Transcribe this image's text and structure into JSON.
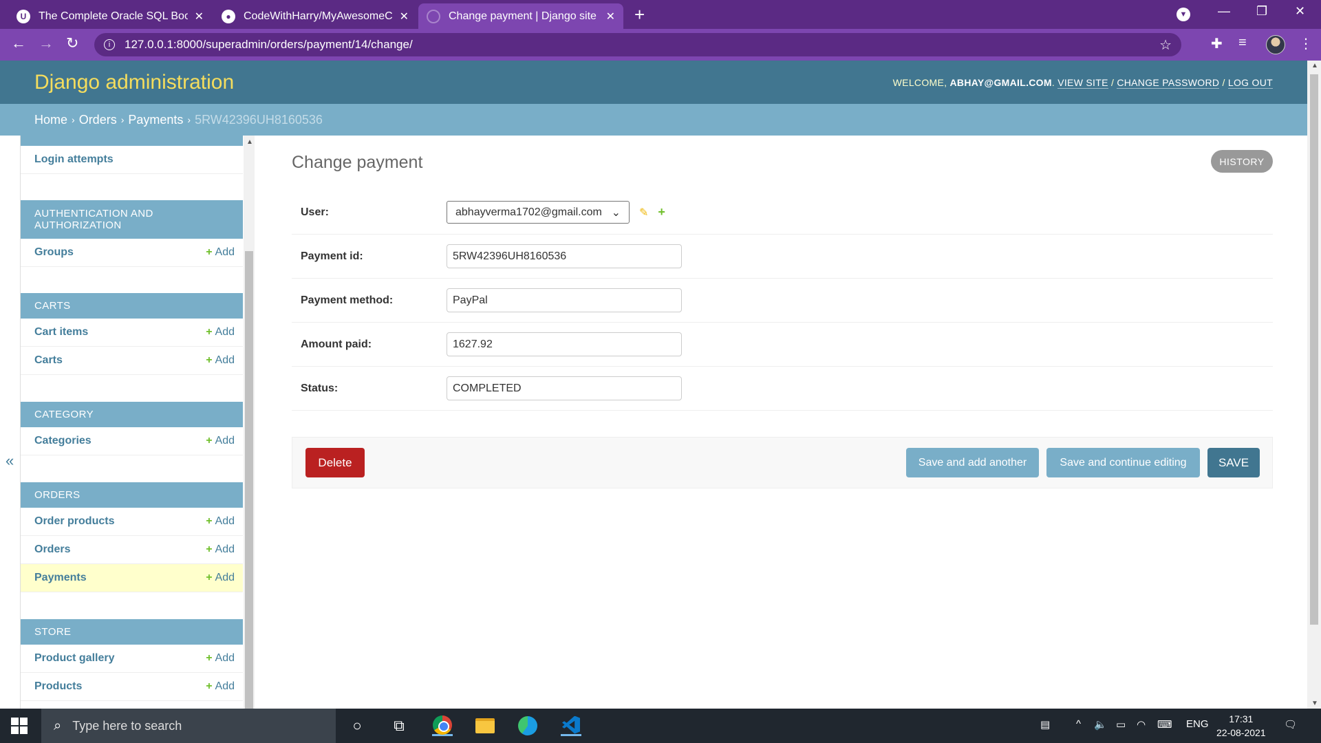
{
  "browser": {
    "tabs": [
      {
        "title": "The Complete Oracle SQL Bootcamp",
        "icon": "udemy-icon"
      },
      {
        "title": "CodeWithHarry/MyAwesomeCart",
        "icon": "github-icon"
      },
      {
        "title": "Change payment | Django site admin",
        "icon": "django-icon"
      }
    ],
    "url": "127.0.0.1:8000/superadmin/orders/payment/14/change/",
    "theme_color": "#5b2a84"
  },
  "header": {
    "branding": "Django administration",
    "welcome": "WELCOME,",
    "user": "ABHAY@GMAIL.COM",
    "view_site": "VIEW SITE",
    "change_password": "CHANGE PASSWORD",
    "log_out": "LOG OUT",
    "slash": "/",
    "period": "."
  },
  "breadcrumbs": {
    "home": "Home",
    "orders": "Orders",
    "payments": "Payments",
    "current": "5RW42396UH8160536",
    "sep": "›"
  },
  "sidebar": {
    "add_label": "Add",
    "add_icon": "+",
    "toggle": "«",
    "modules": [
      {
        "caption": "",
        "items": [
          {
            "label": "Login attempts",
            "add": false
          }
        ]
      },
      {
        "caption": "AUTHENTICATION AND AUTHORIZATION",
        "items": [
          {
            "label": "Groups",
            "add": true
          }
        ]
      },
      {
        "caption": "CARTS",
        "items": [
          {
            "label": "Cart items",
            "add": true
          },
          {
            "label": "Carts",
            "add": true
          }
        ]
      },
      {
        "caption": "CATEGORY",
        "items": [
          {
            "label": "Categories",
            "add": true
          }
        ]
      },
      {
        "caption": "ORDERS",
        "items": [
          {
            "label": "Order products",
            "add": true
          },
          {
            "label": "Orders",
            "add": true
          },
          {
            "label": "Payments",
            "add": true,
            "current": true
          }
        ]
      },
      {
        "caption": "STORE",
        "items": [
          {
            "label": "Product gallery",
            "add": true
          },
          {
            "label": "Products",
            "add": true
          }
        ]
      }
    ]
  },
  "content": {
    "title": "Change payment",
    "history": "HISTORY",
    "fields": {
      "user": {
        "label": "User:",
        "value": "abhayverma1702@gmail.com"
      },
      "payment_id": {
        "label": "Payment id:",
        "value": "5RW42396UH8160536"
      },
      "payment_method": {
        "label": "Payment method:",
        "value": "PayPal"
      },
      "amount_paid": {
        "label": "Amount paid:",
        "value": "1627.92"
      },
      "status": {
        "label": "Status:",
        "value": "COMPLETED"
      }
    },
    "buttons": {
      "delete": "Delete",
      "save_add": "Save and add another",
      "save_continue": "Save and continue editing",
      "save": "SAVE"
    }
  },
  "taskbar": {
    "search_placeholder": "Type here to search",
    "lang": "ENG",
    "time": "17:31",
    "date": "22-08-2021"
  },
  "colors": {
    "header": "#417690",
    "breadcrumbs": "#79aec8",
    "branding": "#f5dd5d",
    "delete": "#ba2121",
    "add_green": "#70bf2b",
    "link": "#447e9b"
  }
}
